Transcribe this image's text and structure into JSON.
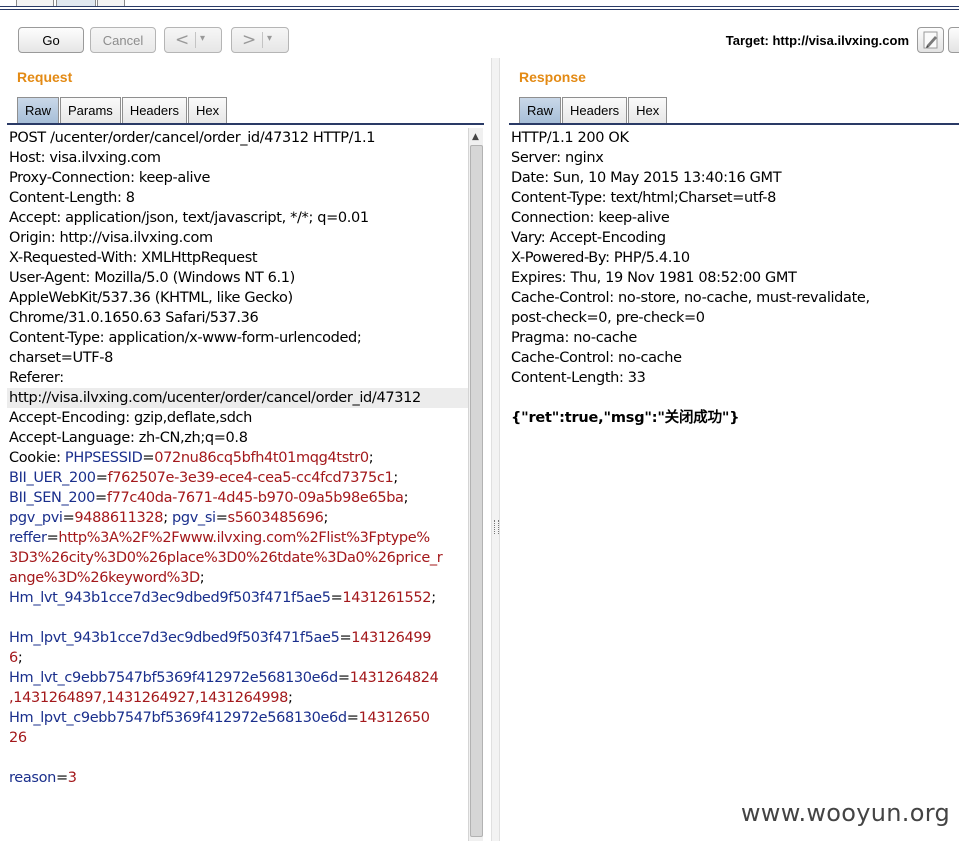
{
  "toolbar": {
    "go_label": "Go",
    "cancel_label": "Cancel",
    "back_glyph": "<",
    "forward_glyph": ">",
    "dropdown_glyph": "▾",
    "target_text": "Target: http://visa.ilvxing.com"
  },
  "request": {
    "title": "Request",
    "tabs": [
      "Raw",
      "Params",
      "Headers",
      "Hex"
    ],
    "active_tab": "Raw",
    "lines": [
      [
        {
          "t": "POST /ucenter/order/cancel/order_id/47312 HTTP/1.1",
          "c": "n"
        }
      ],
      [
        {
          "t": "Host: visa.ilvxing.com",
          "c": "n"
        }
      ],
      [
        {
          "t": "Proxy-Connection: keep-alive",
          "c": "n"
        }
      ],
      [
        {
          "t": "Content-Length: 8",
          "c": "n"
        }
      ],
      [
        {
          "t": "Accept: application/json, text/javascript, */*; q=0.01",
          "c": "n"
        }
      ],
      [
        {
          "t": "Origin: http://visa.ilvxing.com",
          "c": "n"
        }
      ],
      [
        {
          "t": "X-Requested-With: XMLHttpRequest",
          "c": "n"
        }
      ],
      [
        {
          "t": "User-Agent: Mozilla/5.0 (Windows NT 6.1)",
          "c": "n"
        }
      ],
      [
        {
          "t": "AppleWebKit/537.36 (KHTML, like Gecko)",
          "c": "n"
        }
      ],
      [
        {
          "t": "Chrome/31.0.1650.63 Safari/537.36",
          "c": "n"
        }
      ],
      [
        {
          "t": "Content-Type: application/x-www-form-urlencoded;",
          "c": "n"
        }
      ],
      [
        {
          "t": "charset=UTF-8",
          "c": "n"
        }
      ],
      [
        {
          "t": "Referer:",
          "c": "n"
        }
      ],
      [
        {
          "t": "http://visa.ilvxing.com/ucenter/order/cancel/order_id/47312",
          "c": "n",
          "hl": true
        }
      ],
      [
        {
          "t": "Accept-Encoding: gzip,deflate,sdch",
          "c": "n"
        }
      ],
      [
        {
          "t": "Accept-Language: zh-CN,zh;q=0.8",
          "c": "n"
        }
      ],
      [
        {
          "t": "Cookie: ",
          "c": "n"
        },
        {
          "t": "PHPSESSID",
          "c": "k"
        },
        {
          "t": "=",
          "c": "n"
        },
        {
          "t": "072nu86cq5bfh4t01mqg4tstr0",
          "c": "v"
        },
        {
          "t": ";",
          "c": "n"
        }
      ],
      [
        {
          "t": "BII_UER_200",
          "c": "k"
        },
        {
          "t": "=",
          "c": "n"
        },
        {
          "t": "f762507e-3e39-ece4-cea5-cc4fcd7375c1",
          "c": "v"
        },
        {
          "t": ";",
          "c": "n"
        }
      ],
      [
        {
          "t": "BII_SEN_200",
          "c": "k"
        },
        {
          "t": "=",
          "c": "n"
        },
        {
          "t": "f77c40da-7671-4d45-b970-09a5b98e65ba",
          "c": "v"
        },
        {
          "t": ";",
          "c": "n"
        }
      ],
      [
        {
          "t": "pgv_pvi",
          "c": "k"
        },
        {
          "t": "=",
          "c": "n"
        },
        {
          "t": "9488611328",
          "c": "v"
        },
        {
          "t": "; ",
          "c": "n"
        },
        {
          "t": "pgv_si",
          "c": "k"
        },
        {
          "t": "=",
          "c": "n"
        },
        {
          "t": "s5603485696",
          "c": "v"
        },
        {
          "t": ";",
          "c": "n"
        }
      ],
      [
        {
          "t": "reffer",
          "c": "k"
        },
        {
          "t": "=",
          "c": "n"
        },
        {
          "t": "http%3A%2F%2Fwww.ilvxing.com%2Flist%3Fptype%",
          "c": "v"
        }
      ],
      [
        {
          "t": "3D3%26city%3D0%26place%3D0%26tdate%3Da0%26price_r",
          "c": "v"
        }
      ],
      [
        {
          "t": "ange%3D%26keyword%3D",
          "c": "v"
        },
        {
          "t": ";",
          "c": "n"
        }
      ],
      [
        {
          "t": "Hm_lvt_943b1cce7d3ec9dbed9f503f471f5ae5",
          "c": "k"
        },
        {
          "t": "=",
          "c": "n"
        },
        {
          "t": "1431261552",
          "c": "v"
        },
        {
          "t": ";",
          "c": "n"
        }
      ],
      [
        {
          "t": "",
          "c": "n"
        }
      ],
      [
        {
          "t": "Hm_lpvt_943b1cce7d3ec9dbed9f503f471f5ae5",
          "c": "k"
        },
        {
          "t": "=",
          "c": "n"
        },
        {
          "t": "143126499",
          "c": "v"
        }
      ],
      [
        {
          "t": "6",
          "c": "v"
        },
        {
          "t": ";",
          "c": "n"
        }
      ],
      [
        {
          "t": "Hm_lvt_c9ebb7547bf5369f412972e568130e6d",
          "c": "k"
        },
        {
          "t": "=",
          "c": "n"
        },
        {
          "t": "1431264824",
          "c": "v"
        }
      ],
      [
        {
          "t": ",1431264897,1431264927,1431264998",
          "c": "v"
        },
        {
          "t": ";",
          "c": "n"
        }
      ],
      [
        {
          "t": "Hm_lpvt_c9ebb7547bf5369f412972e568130e6d",
          "c": "k"
        },
        {
          "t": "=",
          "c": "n"
        },
        {
          "t": "14312650",
          "c": "v"
        }
      ],
      [
        {
          "t": "26",
          "c": "v"
        }
      ],
      [
        {
          "t": "",
          "c": "n"
        }
      ],
      [
        {
          "t": "reason",
          "c": "k"
        },
        {
          "t": "=",
          "c": "n"
        },
        {
          "t": "3",
          "c": "v"
        }
      ]
    ]
  },
  "response": {
    "title": "Response",
    "tabs": [
      "Raw",
      "Headers",
      "Hex"
    ],
    "active_tab": "Raw",
    "lines": [
      "HTTP/1.1 200 OK",
      "Server: nginx",
      "Date: Sun, 10 May 2015 13:40:16 GMT",
      "Content-Type: text/html;Charset=utf-8",
      "Connection: keep-alive",
      "Vary: Accept-Encoding",
      "X-Powered-By: PHP/5.4.10",
      "Expires: Thu, 19 Nov 1981 08:52:00 GMT",
      "Cache-Control: no-store, no-cache, must-revalidate,",
      "post-check=0, pre-check=0",
      "Pragma: no-cache",
      "Cache-Control: no-cache",
      "Content-Length: 33",
      ""
    ],
    "body": "{\"ret\":true,\"msg\":\"关闭成功\"}"
  },
  "watermark": "www.wooyun.org",
  "colors": {
    "section_title": "#e38a14",
    "param_name": "#1a2f8c",
    "param_value": "#a3181b"
  }
}
